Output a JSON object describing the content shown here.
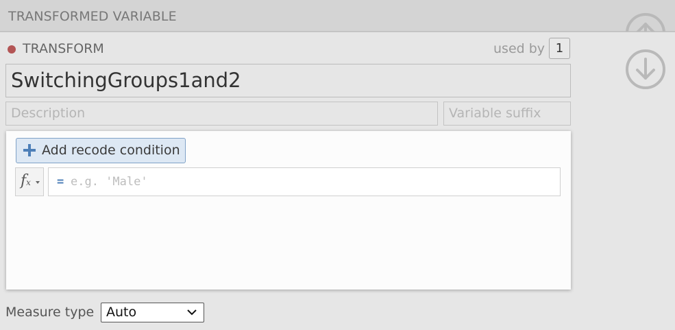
{
  "header": {
    "title": "TRANSFORMED VARIABLE",
    "up_icon": "arrow-up-circle-icon",
    "down_icon": "arrow-down-circle-icon"
  },
  "transform": {
    "status_color": "#b35555",
    "label": "TRANSFORM",
    "used_by_label": "used by",
    "used_by_count": "1",
    "name": "SwitchingGroups1and2",
    "description_placeholder": "Description",
    "suffix_placeholder": "Variable suffix"
  },
  "recode": {
    "add_label": "Add recode condition",
    "add_icon": "plus-icon",
    "fx_icon": "function-icon",
    "equals": "=",
    "formula_placeholder": "e.g. 'Male'"
  },
  "measure": {
    "label": "Measure type",
    "selected": "Auto"
  },
  "colors": {
    "accent": "#4d7fb8",
    "add_button_bg": "#dde8f4"
  }
}
